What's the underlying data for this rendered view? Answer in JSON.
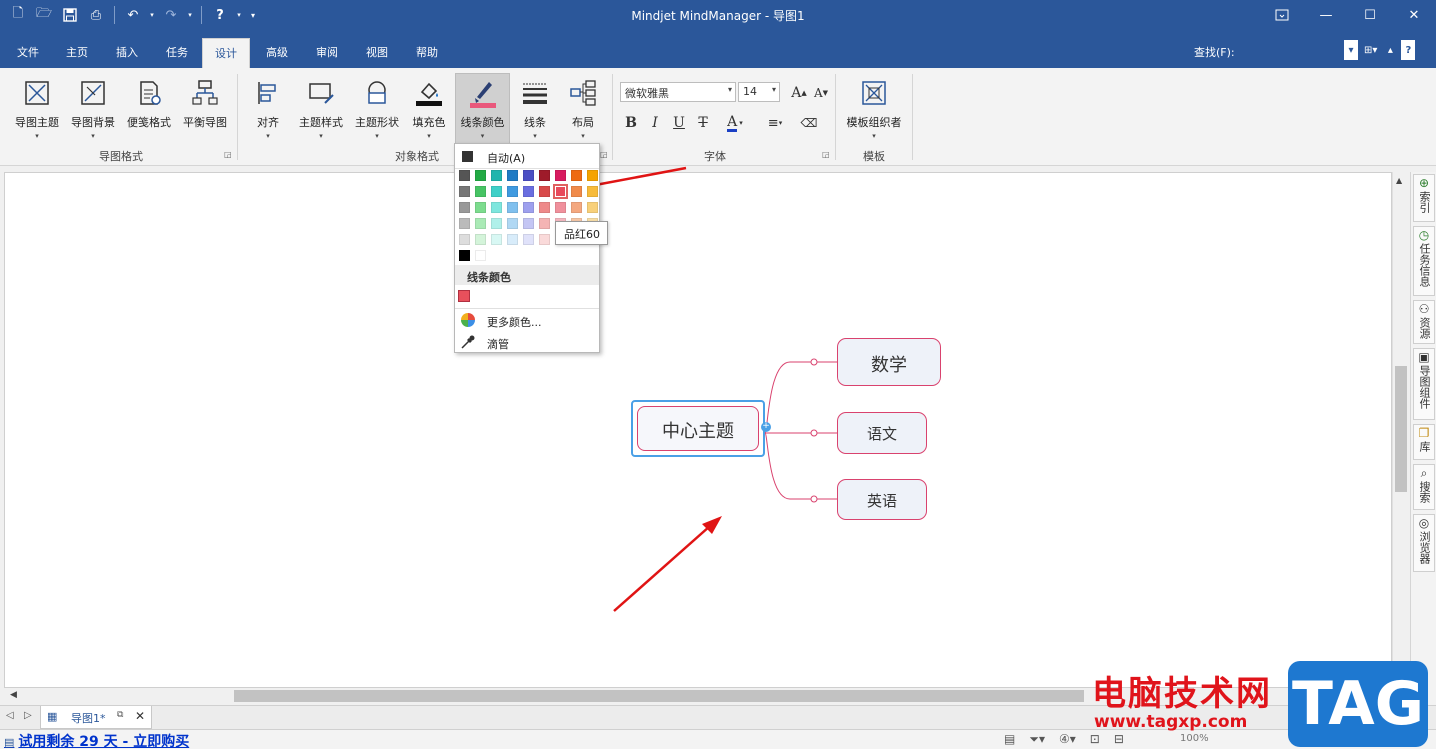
{
  "window": {
    "title": "Mindjet MindManager - 导图1"
  },
  "ribbon_tabs": [
    {
      "label": "文件"
    },
    {
      "label": "主页"
    },
    {
      "label": "插入"
    },
    {
      "label": "任务"
    },
    {
      "label": "设计",
      "active": true
    },
    {
      "label": "高级"
    },
    {
      "label": "审阅"
    },
    {
      "label": "视图"
    },
    {
      "label": "帮助"
    }
  ],
  "find_label": "查找(F):",
  "groups": {
    "map_format": {
      "label": "导图格式",
      "buttons": [
        "导图主题",
        "导图背景",
        "便笺格式",
        "平衡导图"
      ]
    },
    "object_format": {
      "label": "对象格式",
      "buttons": [
        "对齐",
        "主题样式",
        "主题形状",
        "填充色",
        "线条颜色",
        "线条",
        "布局"
      ]
    },
    "font": {
      "label": "字体",
      "font_name": "微软雅黑",
      "font_size": "14"
    },
    "template": {
      "label": "模板",
      "buttons": [
        "模板组织者"
      ]
    }
  },
  "line_color_menu": {
    "auto_label": "自动(A)",
    "section_label": "线条颜色",
    "recent_color": "#e8505c",
    "more_colors": "更多颜色...",
    "eyedropper": "滴管",
    "palette_rows": [
      [
        "#555555",
        "#22aa44",
        "#1fb5ad",
        "#1f7bc4",
        "#4b4fc4",
        "#9e1b2a",
        "#d81b60",
        "#ee6a12",
        "#f5a300"
      ],
      [
        "#777777",
        "#47c464",
        "#3fd0c8",
        "#3f9ae0",
        "#6a6ee0",
        "#d84a4a",
        "#e84a5c",
        "#f08a4a",
        "#f7bb3a"
      ],
      [
        "#999999",
        "#7cdc8e",
        "#7ee6de",
        "#80c0ee",
        "#9ea0ee",
        "#ee8a8a",
        "#f0909c",
        "#f4a880",
        "#f8d07a"
      ],
      [
        "#bbbbbb",
        "#aaeab6",
        "#b0f0ea",
        "#b0d8f4",
        "#c4c6f4",
        "#f4b4b4",
        "#f6b8c0",
        "#f8c8a8",
        "#fae0a8"
      ],
      [
        "#dddddd",
        "#d4f4da",
        "#d8f8f4",
        "#d8ecfa",
        "#e0e2fa",
        "#fadada",
        "#fadce0",
        "#fce2d0",
        "#fdf0d0"
      ],
      [
        "#000000",
        "#ffffff"
      ]
    ],
    "tooltip": "品红60"
  },
  "mindmap": {
    "central": "中心主题",
    "subtopics": [
      "数学",
      "语文",
      "英语"
    ]
  },
  "sidebar_items": [
    "索引",
    "任务信息",
    "资源",
    "导图组件",
    "库",
    "搜索",
    "浏览器"
  ],
  "doc_tab": {
    "name": "导图1*"
  },
  "status": {
    "trial_text": "试用剩余 29 天 - 立即购买",
    "zoom": "100%"
  },
  "watermark": {
    "site_name": "电脑技术网",
    "url": "www.tagxp.com",
    "tag": "TAG"
  },
  "colors": {
    "accent": "#2b579a",
    "topic_border": "#d9426e",
    "selection": "#4aa0e6",
    "arrow": "#e01414"
  },
  "icons": {
    "qat": [
      "new-file-icon",
      "open-icon",
      "save-icon",
      "print-icon",
      "undo-icon",
      "redo-icon",
      "help-icon",
      "customize-icon"
    ],
    "window": [
      "restore-ribbon-icon",
      "minimize-icon",
      "maximize-icon",
      "close-icon"
    ]
  }
}
